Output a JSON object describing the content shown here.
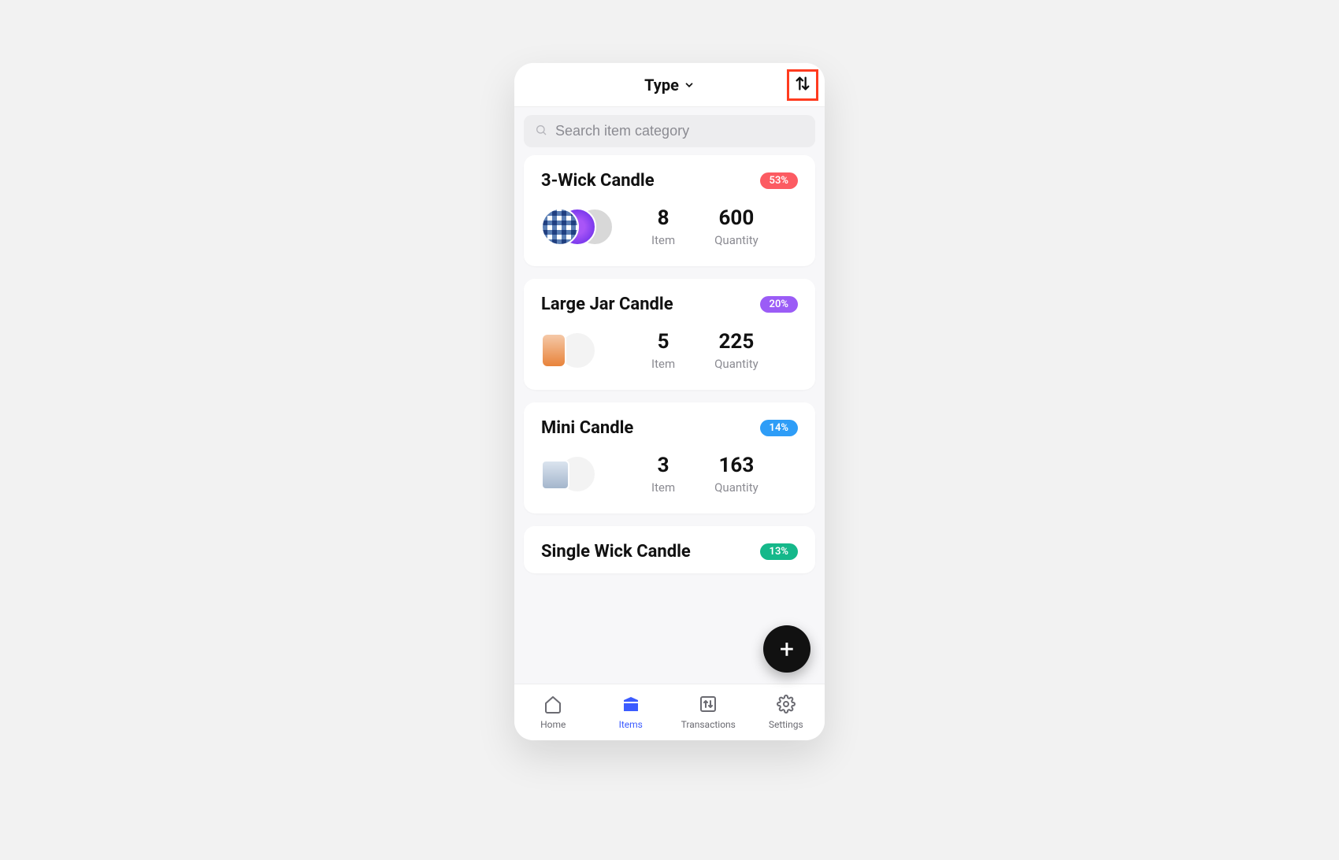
{
  "header": {
    "title": "Type"
  },
  "search": {
    "placeholder": "Search item category"
  },
  "labels": {
    "item": "Item",
    "quantity": "Quantity"
  },
  "categories": [
    {
      "name": "3-Wick Candle",
      "percent": "53%",
      "badge_color": "red",
      "item_count": "8",
      "quantity": "600"
    },
    {
      "name": "Large Jar Candle",
      "percent": "20%",
      "badge_color": "purple",
      "item_count": "5",
      "quantity": "225"
    },
    {
      "name": "Mini Candle",
      "percent": "14%",
      "badge_color": "blue",
      "item_count": "3",
      "quantity": "163"
    },
    {
      "name": "Single Wick Candle",
      "percent": "13%",
      "badge_color": "teal",
      "item_count": "",
      "quantity": ""
    }
  ],
  "nav": {
    "home": "Home",
    "items": "Items",
    "transactions": "Transactions",
    "settings": "Settings"
  }
}
